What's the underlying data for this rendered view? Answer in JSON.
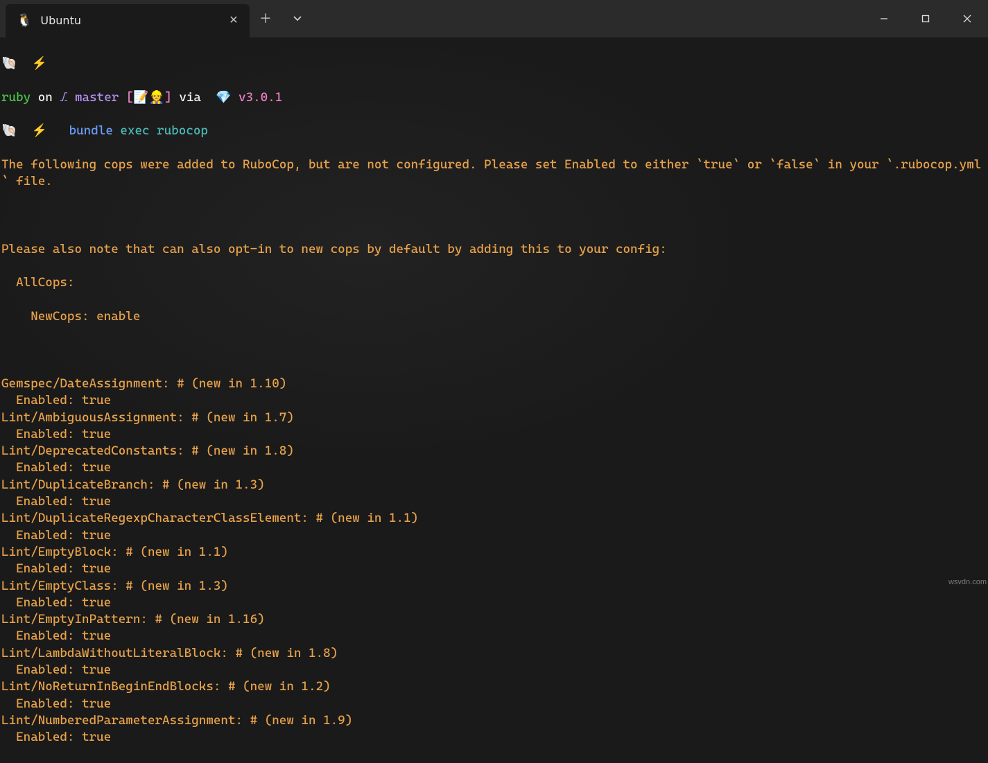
{
  "window": {
    "tab_title": "Ubuntu",
    "tab_icon": "🐧"
  },
  "prompt1": {
    "shell_icon": "🐚",
    "bolt": "⚡"
  },
  "prompt2": {
    "project": "ruby",
    "on": "on",
    "branch_icon": "⎇",
    "branch": "master",
    "bracket_open": "[",
    "emoji1": "📝",
    "emoji2": "👷",
    "bracket_close": "]",
    "via": "via",
    "gem": "💎",
    "version": "v3.0.1"
  },
  "prompt3": {
    "shell_icon": "🐚",
    "bolt": "⚡",
    "cmd_bundle": "bundle",
    "cmd_exec": "exec",
    "cmd_rubocop": "rubocop"
  },
  "output": {
    "warn1": "The following cops were added to RuboCop, but are not configured. Please set Enabled to either `true` or `false` in your `.rubocop.yml` file.",
    "warn2": "Please also note that can also opt-in to new cops by default by adding this to your config:",
    "allcops": "  AllCops:",
    "newcops": "    NewCops: enable",
    "cops": [
      {
        "name": "Gemspec/DateAssignment: # (new in 1.10)",
        "enabled": "  Enabled: true"
      },
      {
        "name": "Lint/AmbiguousAssignment: # (new in 1.7)",
        "enabled": "  Enabled: true"
      },
      {
        "name": "Lint/DeprecatedConstants: # (new in 1.8)",
        "enabled": "  Enabled: true"
      },
      {
        "name": "Lint/DuplicateBranch: # (new in 1.3)",
        "enabled": "  Enabled: true"
      },
      {
        "name": "Lint/DuplicateRegexpCharacterClassElement: # (new in 1.1)",
        "enabled": "  Enabled: true"
      },
      {
        "name": "Lint/EmptyBlock: # (new in 1.1)",
        "enabled": "  Enabled: true"
      },
      {
        "name": "Lint/EmptyClass: # (new in 1.3)",
        "enabled": "  Enabled: true"
      },
      {
        "name": "Lint/EmptyInPattern: # (new in 1.16)",
        "enabled": "  Enabled: true"
      },
      {
        "name": "Lint/LambdaWithoutLiteralBlock: # (new in 1.8)",
        "enabled": "  Enabled: true"
      },
      {
        "name": "Lint/NoReturnInBeginEndBlocks: # (new in 1.2)",
        "enabled": "  Enabled: true"
      },
      {
        "name": "Lint/NumberedParameterAssignment: # (new in 1.9)",
        "enabled": "  Enabled: true"
      }
    ]
  },
  "watermark": "wsvdn.com"
}
